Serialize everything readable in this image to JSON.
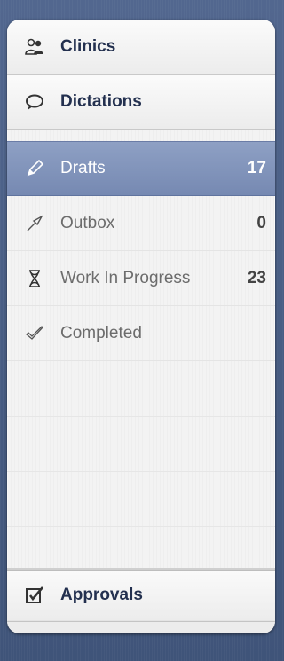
{
  "sidebar": {
    "clinics_label": "Clinics",
    "dictations_label": "Dictations",
    "items": [
      {
        "label": "Drafts",
        "count": "17",
        "icon": "pencil-icon"
      },
      {
        "label": "Outbox",
        "count": "0",
        "icon": "outbox-arrow-icon"
      },
      {
        "label": "Work In Progress",
        "count": "23",
        "icon": "hourglass-icon"
      },
      {
        "label": "Completed",
        "count": "",
        "icon": "checkmark-icon"
      }
    ],
    "approvals_label": "Approvals"
  },
  "colors": {
    "selected": "#7f92ba",
    "header_text": "#23304f",
    "item_text": "#6c6c6c"
  }
}
